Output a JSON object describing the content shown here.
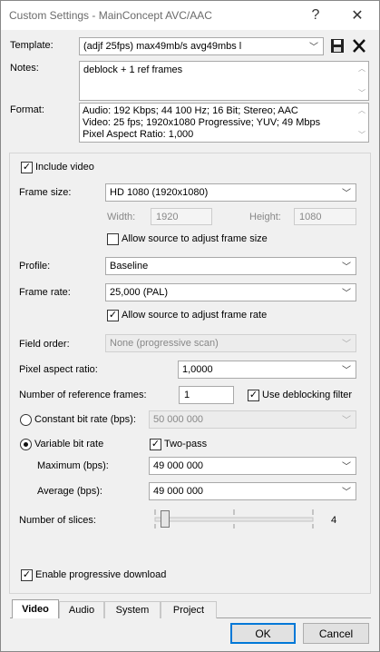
{
  "window": {
    "title": "Custom Settings - MainConcept AVC/AAC",
    "help_glyph": "?",
    "close_glyph": "✕"
  },
  "template": {
    "label": "Template:",
    "value": "(adjf 25fps) max49mb/s avg49mbs l"
  },
  "notes": {
    "label": "Notes:",
    "value": "deblock + 1 ref frames"
  },
  "format": {
    "label": "Format:",
    "lines": [
      "Audio: 192 Kbps; 44 100 Hz; 16 Bit; Stereo; AAC",
      "Video: 25 fps; 1920x1080 Progressive; YUV; 49 Mbps",
      "Pixel Aspect Ratio: 1,000"
    ]
  },
  "video": {
    "include_video": {
      "label": "Include video",
      "checked": true
    },
    "frame_size": {
      "label": "Frame size:",
      "value": "HD 1080 (1920x1080)"
    },
    "width": {
      "label": "Width:",
      "value": "1920"
    },
    "height": {
      "label": "Height:",
      "value": "1080"
    },
    "allow_source_size": {
      "label": "Allow source to adjust frame size",
      "checked": false
    },
    "profile": {
      "label": "Profile:",
      "value": "Baseline"
    },
    "frame_rate": {
      "label": "Frame rate:",
      "value": "25,000 (PAL)"
    },
    "allow_source_rate": {
      "label": "Allow source to adjust frame rate",
      "checked": true
    },
    "field_order": {
      "label": "Field order:",
      "value": "None (progressive scan)"
    },
    "pixel_aspect": {
      "label": "Pixel aspect ratio:",
      "value": "1,0000"
    },
    "ref_frames": {
      "label": "Number of reference frames:",
      "value": "1"
    },
    "deblocking": {
      "label": "Use deblocking filter",
      "checked": true
    },
    "constant_bitrate": {
      "label": "Constant bit rate (bps):",
      "value": "50 000 000",
      "selected": false
    },
    "variable_bitrate": {
      "label": "Variable bit rate",
      "selected": true
    },
    "two_pass": {
      "label": "Two-pass",
      "checked": true
    },
    "maximum": {
      "label": "Maximum (bps):",
      "value": "49 000 000"
    },
    "average": {
      "label": "Average (bps):",
      "value": "49 000 000"
    },
    "slices": {
      "label": "Number of slices:",
      "value": "4",
      "level": 1,
      "min": 1,
      "max": 4
    },
    "progressive_download": {
      "label": "Enable progressive download",
      "checked": true
    }
  },
  "tabs": [
    {
      "label": "Video",
      "active": true
    },
    {
      "label": "Audio",
      "active": false
    },
    {
      "label": "System",
      "active": false
    },
    {
      "label": "Project",
      "active": false
    }
  ],
  "buttons": {
    "ok": "OK",
    "cancel": "Cancel"
  },
  "glyphs": {
    "check": "✓",
    "dropdown": "﹀"
  }
}
